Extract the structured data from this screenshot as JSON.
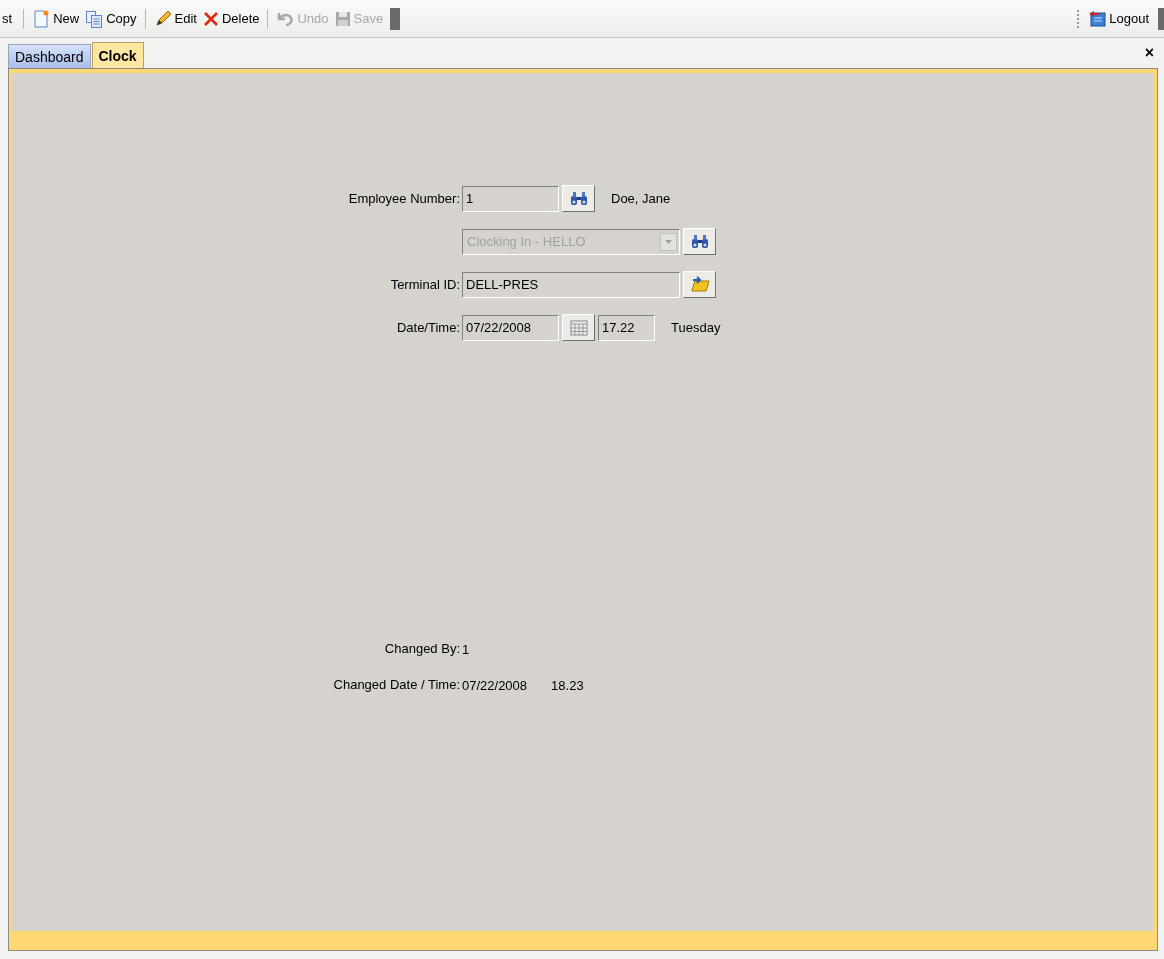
{
  "toolbar": {
    "leading_text": "st",
    "items": [
      {
        "kind": "new",
        "label": "New",
        "disabled": false
      },
      {
        "kind": "copy",
        "label": "Copy",
        "disabled": false
      },
      {
        "kind": "edit",
        "label": "Edit",
        "disabled": false
      },
      {
        "kind": "delete",
        "label": "Delete",
        "disabled": false
      },
      {
        "kind": "undo",
        "label": "Undo",
        "disabled": true
      },
      {
        "kind": "save",
        "label": "Save",
        "disabled": true
      }
    ],
    "logout": {
      "label": "Logout"
    }
  },
  "tabs": [
    {
      "label": "Dashboard",
      "selected": false
    },
    {
      "label": "Clock",
      "selected": true
    }
  ],
  "close_tab": "×",
  "form": {
    "employee_number": {
      "label": "Employee Number:",
      "value": "1",
      "name": "Doe, Jane"
    },
    "reason": {
      "value": "Clocking In - HELLO",
      "disabled": true
    },
    "terminal_id": {
      "label": "Terminal ID:",
      "value": "DELL-PRES"
    },
    "date_time": {
      "label": "Date/Time:",
      "date": "07/22/2008",
      "time": "17.22",
      "day": "Tuesday"
    }
  },
  "audit": {
    "changed_by": {
      "label": "Changed By:",
      "value": "1"
    },
    "changed_date_time": {
      "label": "Changed Date / Time:",
      "date": "07/22/2008",
      "time": "18.23"
    }
  }
}
